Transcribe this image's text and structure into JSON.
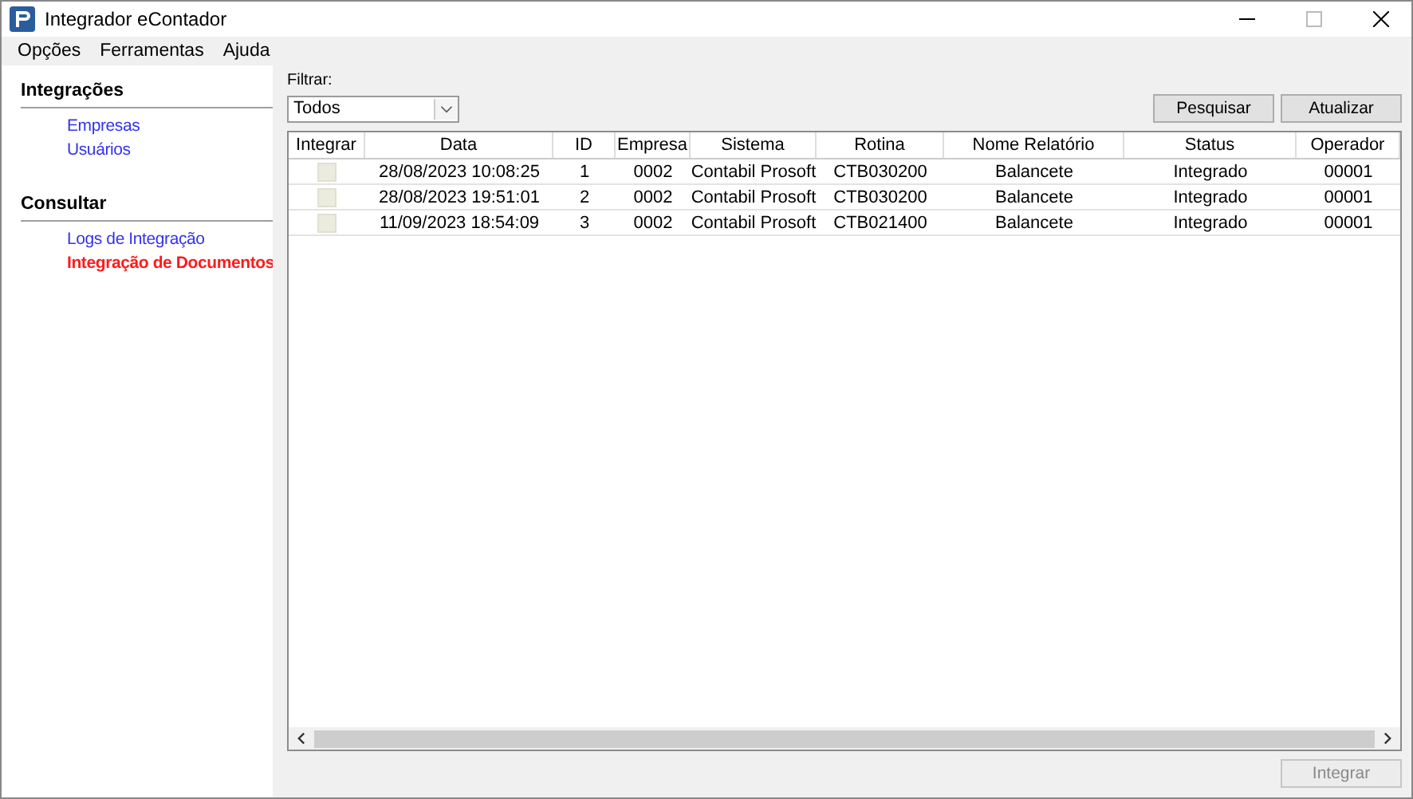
{
  "window": {
    "title": "Integrador eContador"
  },
  "menu": [
    "Opções",
    "Ferramentas",
    "Ajuda"
  ],
  "sidebar": {
    "sections": [
      {
        "title": "Integrações",
        "items": [
          {
            "label": "Empresas",
            "selected": false
          },
          {
            "label": "Usuários",
            "selected": false
          }
        ]
      },
      {
        "title": "Consultar",
        "items": [
          {
            "label": "Logs de Integração",
            "selected": false
          },
          {
            "label": "Integração de Documentos",
            "selected": true
          }
        ]
      }
    ]
  },
  "filter": {
    "label": "Filtrar:",
    "value": "Todos"
  },
  "buttons": [
    {
      "label": "Pesquisar",
      "disabled": false
    },
    {
      "label": "Atualizar",
      "disabled": false
    }
  ],
  "table": {
    "columns": [
      "Integrar",
      "Data",
      "ID",
      "Empresa",
      "Sistema",
      "Rotina",
      "Nome Relatório",
      "Status",
      "Operador"
    ],
    "rows": [
      {
        "checked": false,
        "cells": [
          "",
          "28/08/2023 10:08:25",
          "1",
          "0002",
          "Contabil Prosoft",
          "CTB030200",
          "Balancete",
          "Integrado",
          "00001"
        ]
      },
      {
        "checked": false,
        "cells": [
          "",
          "28/08/2023 19:51:01",
          "2",
          "0002",
          "Contabil Prosoft",
          "CTB030200",
          "Balancete",
          "Integrado",
          "00001"
        ]
      },
      {
        "checked": false,
        "cells": [
          "",
          "11/09/2023 18:54:09",
          "3",
          "0002",
          "Contabil Prosoft",
          "CTB021400",
          "Balancete",
          "Integrado",
          "00001"
        ]
      }
    ]
  },
  "footer_button": {
    "label": "Integrar",
    "disabled": true
  }
}
